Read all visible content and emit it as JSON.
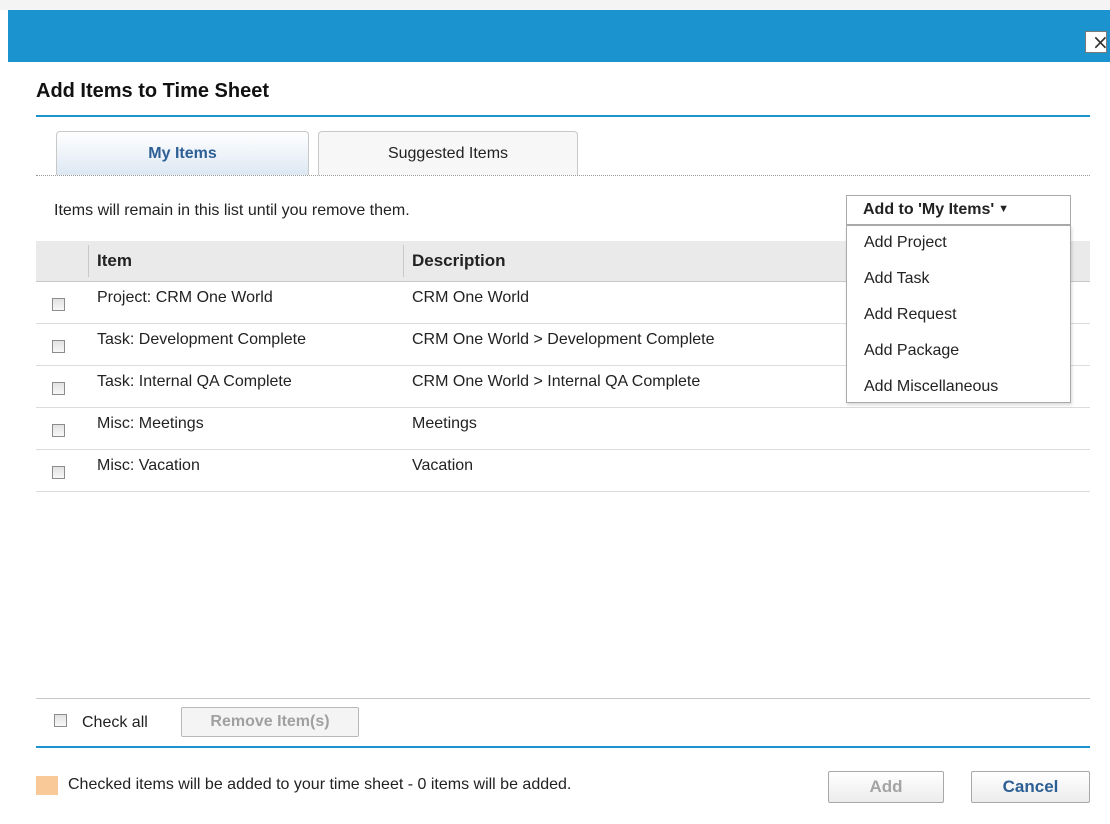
{
  "dialog": {
    "title": "Add Items to Time Sheet",
    "close_symbol": "×",
    "accent_color": "#1a93cf"
  },
  "tabs": [
    {
      "label": "My Items",
      "active": true
    },
    {
      "label": "Suggested Items",
      "active": false
    }
  ],
  "info_text": "Items will remain in this list until you remove them.",
  "add_dropdown": {
    "label": "Add to 'My Items'",
    "caret": "▼",
    "options": [
      "Add Project",
      "Add Task",
      "Add Request",
      "Add Package",
      "Add Miscellaneous"
    ]
  },
  "table": {
    "columns": [
      "Item",
      "Description"
    ],
    "rows": [
      {
        "item": "Project: CRM One World",
        "description": "CRM One World",
        "checked": false
      },
      {
        "item": "Task: Development Complete",
        "description": "CRM One World > Development Complete",
        "checked": false
      },
      {
        "item": "Task: Internal QA Complete",
        "description": "CRM One World > Internal QA Complete",
        "checked": false
      },
      {
        "item": "Misc: Meetings",
        "description": "Meetings",
        "checked": false
      },
      {
        "item": "Misc: Vacation",
        "description": "Vacation",
        "checked": false
      }
    ]
  },
  "footer": {
    "check_all_label": "Check all",
    "remove_button_label": "Remove Item(s)",
    "status_text": "Checked items will be added to your time sheet - 0 items will be added.",
    "legend_color": "#f9c998",
    "add_button_label": "Add",
    "cancel_button_label": "Cancel"
  }
}
